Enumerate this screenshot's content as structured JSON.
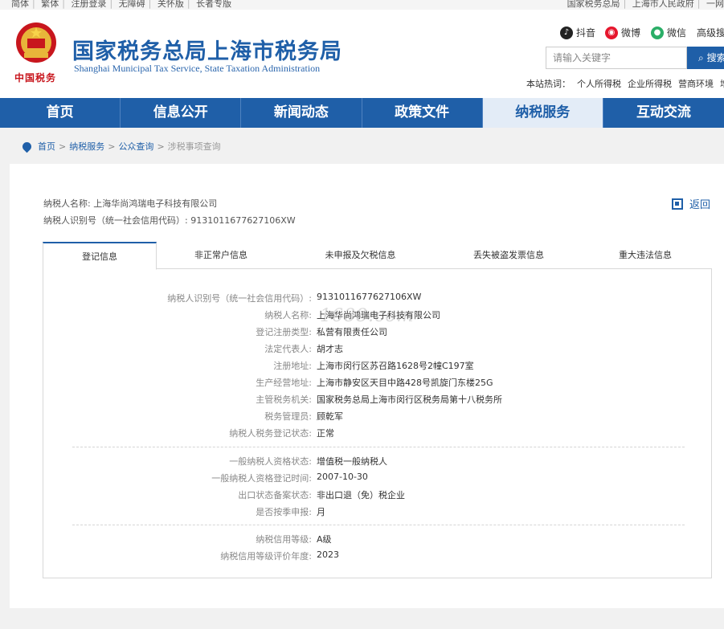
{
  "topbar": {
    "left_links": [
      "简体",
      "繁体",
      "注册登录",
      "无障碍",
      "关怀版",
      "长者专版"
    ],
    "right_links": [
      "国家税务总局",
      "上海市人民政府",
      "一网"
    ]
  },
  "header": {
    "emblem_text": "中国税务",
    "title": "国家税务总局上海市税务局",
    "subtitle": "Shanghai Municipal Tax Service, State Taxation Administration",
    "social": [
      {
        "label": "抖音",
        "icon": "douyin-icon",
        "color": "#222222"
      },
      {
        "label": "微博",
        "icon": "weibo-icon",
        "color": "#e6162d"
      },
      {
        "label": "微信",
        "icon": "wechat-icon",
        "color": "#2aae67"
      }
    ],
    "senior_link": "高级搜",
    "search": {
      "placeholder": "请输入关键字",
      "button": "搜索"
    },
    "hot_label": "本站热词：",
    "hot_words": [
      "个人所得税",
      "企业所得税",
      "营商环境",
      "增值"
    ]
  },
  "nav": {
    "items": [
      "首页",
      "信息公开",
      "新闻动态",
      "政策文件",
      "纳税服务",
      "互动交流"
    ],
    "active_index": 4
  },
  "breadcrumb": {
    "items": [
      "首页",
      "纳税服务",
      "公众查询"
    ],
    "current": "涉税事项查询"
  },
  "taxpayer": {
    "name_label": "纳税人名称:",
    "name": "上海华尚鸿瑞电子科技有限公司",
    "id_label": "纳税人识别号（统一社会信用代码）:",
    "id": "9131011677627106XW"
  },
  "back_label": "返回",
  "tabs": [
    "登记信息",
    "非正常户信息",
    "未申报及欠税信息",
    "丢失被盗发票信息",
    "重大违法信息"
  ],
  "active_tab": 0,
  "registration": {
    "group1": [
      {
        "label": "纳税人识别号（统一社会信用代码）:",
        "value": "9131011677627106XW"
      },
      {
        "label": "纳税人名称:",
        "value": "上海华尚鸿瑞电子科技有限公司"
      },
      {
        "label": "登记注册类型:",
        "value": "私营有限责任公司"
      },
      {
        "label": "法定代表人:",
        "value": "胡才志"
      },
      {
        "label": "注册地址:",
        "value": "上海市闵行区苏召路1628号2幢C197室"
      },
      {
        "label": "生产经营地址:",
        "value": "上海市静安区天目中路428号凯旋门东楼25G"
      },
      {
        "label": "主管税务机关:",
        "value": "国家税务总局上海市闵行区税务局第十八税务所"
      },
      {
        "label": "税务管理员:",
        "value": "顾乾军"
      },
      {
        "label": "纳税人税务登记状态:",
        "value": "正常"
      }
    ],
    "group2": [
      {
        "label": "一般纳税人资格状态:",
        "value": "增值税一般纳税人"
      },
      {
        "label": "一般纳税人资格登记时间:",
        "value": "2007-10-30"
      },
      {
        "label": "出口状态备案状态:",
        "value": "非出口退（免）税企业"
      },
      {
        "label": "是否按季申报:",
        "value": "月"
      }
    ],
    "group3": [
      {
        "label": "纳税信用等级:",
        "value": "A级"
      },
      {
        "label": "纳税信用等级评价年度:",
        "value": "2023"
      }
    ]
  },
  "watermark": "1688.com"
}
